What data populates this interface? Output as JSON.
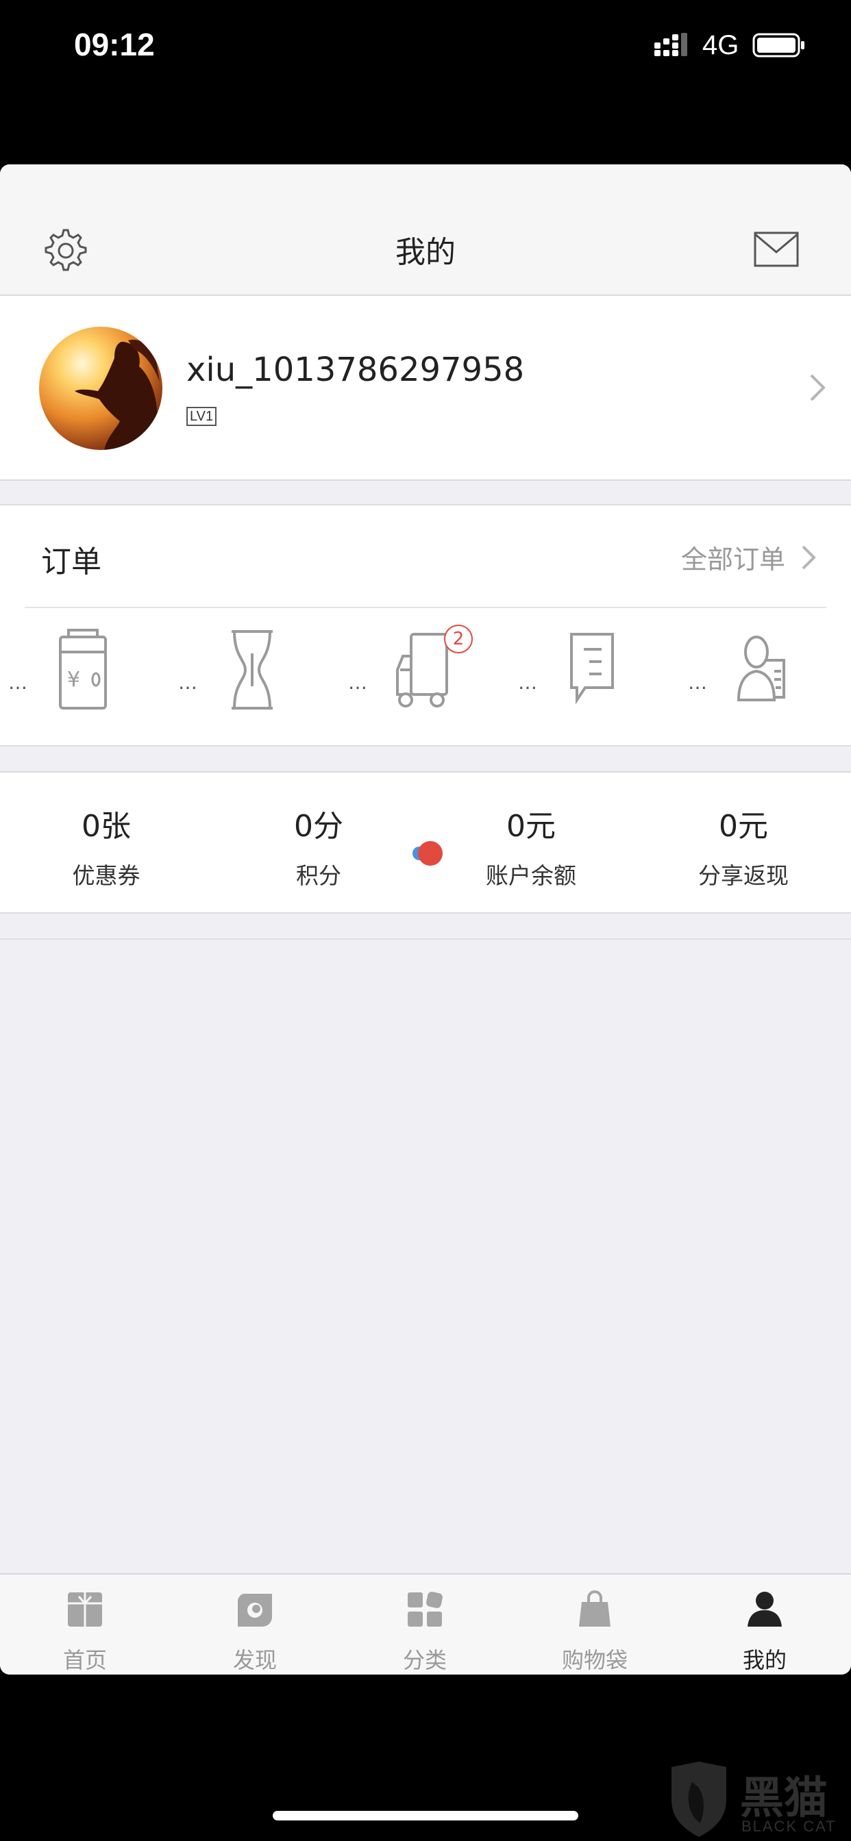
{
  "status_bar": {
    "time": "09:12",
    "network": "4G"
  },
  "nav": {
    "title": "我的"
  },
  "profile": {
    "username": "xiu_1013786297958",
    "level": "LV1"
  },
  "orders": {
    "title": "订单",
    "all_orders": "全部订单",
    "items": [
      {
        "icon": "payment-pending-icon",
        "dots": "…",
        "badge": ""
      },
      {
        "icon": "hourglass-icon",
        "dots": "…",
        "badge": ""
      },
      {
        "icon": "delivery-truck-icon",
        "dots": "…",
        "badge": "2"
      },
      {
        "icon": "review-chat-icon",
        "dots": "…",
        "badge": ""
      },
      {
        "icon": "after-sales-service-icon",
        "dots": "…",
        "badge": ""
      }
    ]
  },
  "stats": [
    {
      "value": "0张",
      "label": "优惠券"
    },
    {
      "value": "0分",
      "label": "积分"
    },
    {
      "value": "0元",
      "label": "账户余额"
    },
    {
      "value": "0元",
      "label": "分享返现"
    }
  ],
  "tabs": [
    {
      "label": "首页",
      "icon": "home-gift-icon",
      "active": false
    },
    {
      "label": "发现",
      "icon": "discover-icon",
      "active": false
    },
    {
      "label": "分类",
      "icon": "category-icon",
      "active": false
    },
    {
      "label": "购物袋",
      "icon": "shopping-bag-icon",
      "active": false
    },
    {
      "label": "我的",
      "icon": "profile-icon",
      "active": true
    }
  ],
  "watermark": {
    "text": "黑猫",
    "sub": "BLACK CAT"
  },
  "colors": {
    "badge": "#e24a3f",
    "background": "#efeff4",
    "active_tab": "#222222",
    "inactive_tab": "#999999"
  }
}
